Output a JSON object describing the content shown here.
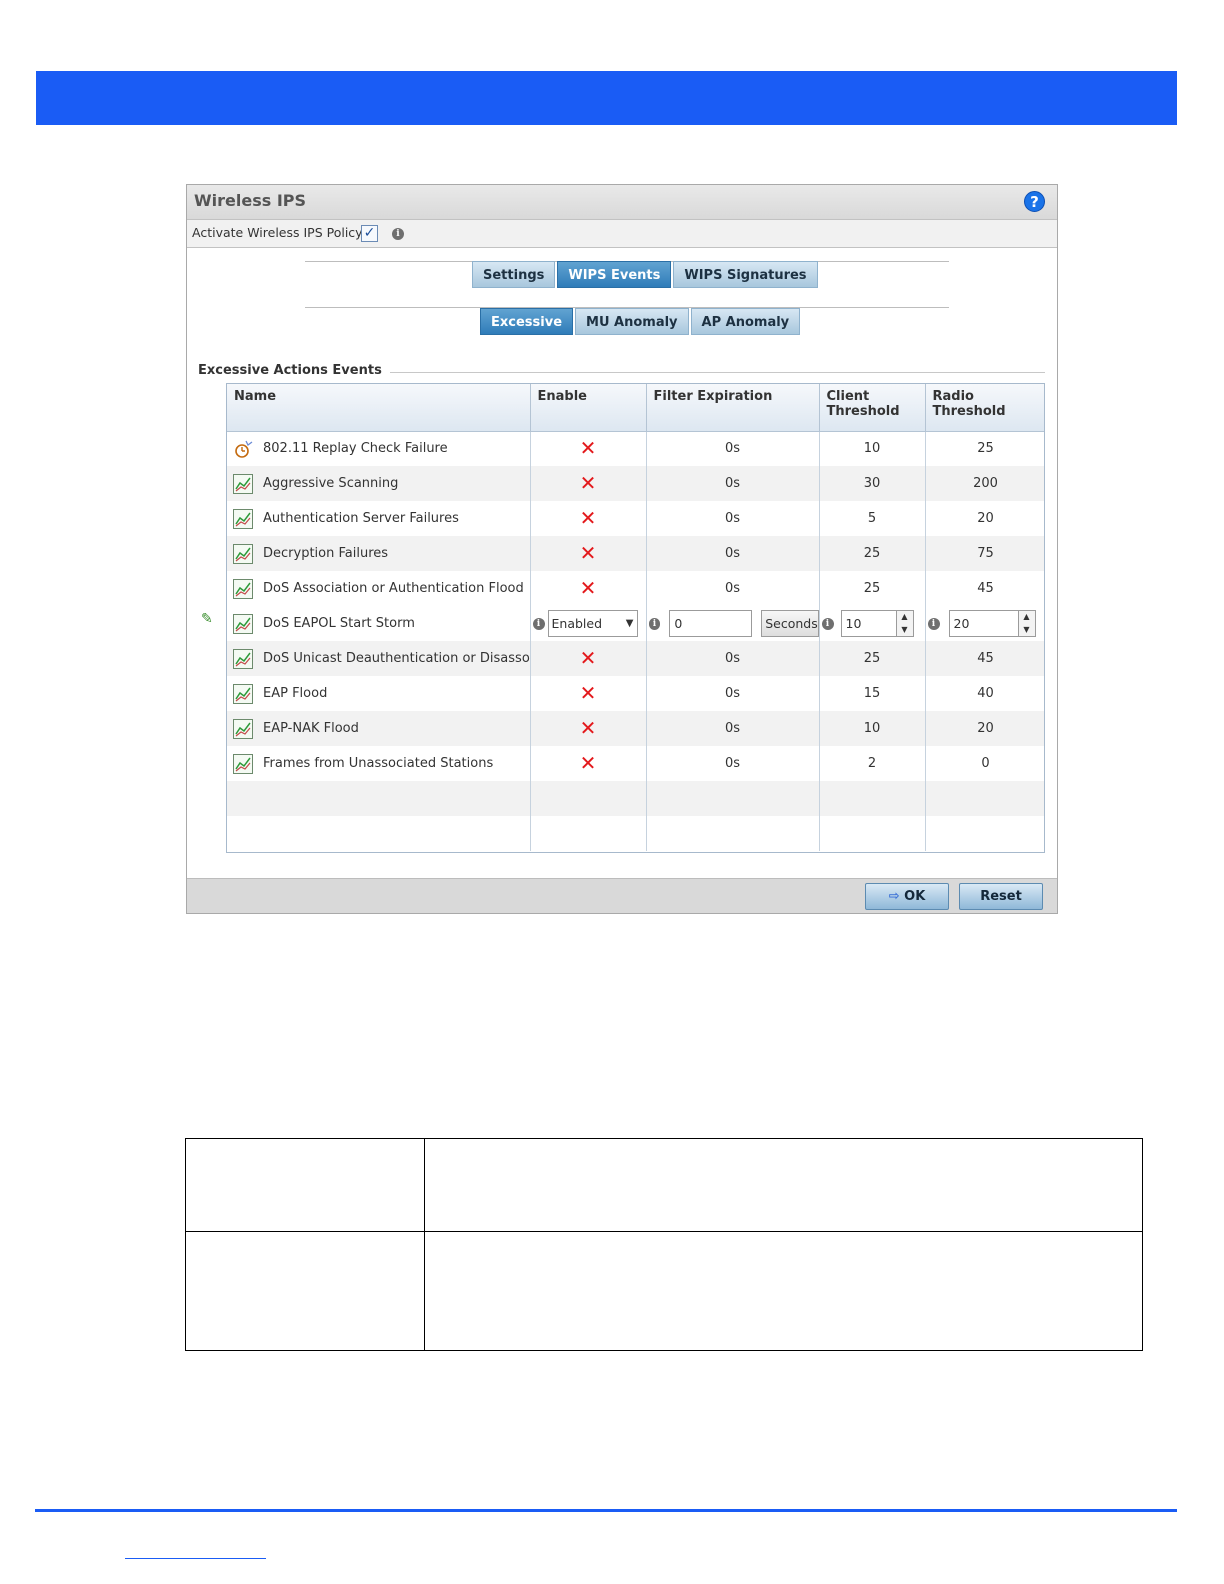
{
  "dialog": {
    "title": "Wireless IPS",
    "help_icon": "help-icon",
    "activate_label": "Activate Wireless IPS Policy",
    "activate_checked": true
  },
  "tabs": [
    {
      "label": "Settings",
      "active": false
    },
    {
      "label": "WIPS Events",
      "active": true
    },
    {
      "label": "WIPS Signatures",
      "active": false
    }
  ],
  "subtabs": [
    {
      "label": "Excessive",
      "active": true
    },
    {
      "label": "MU Anomaly",
      "active": false
    },
    {
      "label": "AP Anomaly",
      "active": false
    }
  ],
  "section_title": "Excessive Actions Events",
  "table": {
    "columns": [
      "Name",
      "Enable",
      "Filter Expiration",
      "Client Threshold",
      "Radio Threshold"
    ],
    "rows": [
      {
        "name": "802.11 Replay Check Failure",
        "icon": "replay-icon",
        "enable": "disabled",
        "filter": "0s",
        "client": "10",
        "radio": "25"
      },
      {
        "name": "Aggressive Scanning",
        "icon": "chart-icon",
        "enable": "disabled",
        "filter": "0s",
        "client": "30",
        "radio": "200"
      },
      {
        "name": "Authentication Server Failures",
        "icon": "chart-icon",
        "enable": "disabled",
        "filter": "0s",
        "client": "5",
        "radio": "20"
      },
      {
        "name": "Decryption Failures",
        "icon": "chart-icon",
        "enable": "disabled",
        "filter": "0s",
        "client": "25",
        "radio": "75"
      },
      {
        "name": "DoS Association or Authentication Flood",
        "icon": "chart-icon",
        "enable": "disabled",
        "filter": "0s",
        "client": "25",
        "radio": "45"
      },
      {
        "name": "DoS EAPOL Start Storm",
        "icon": "chart-icon",
        "editing": true,
        "enable_value": "Enabled",
        "filter_value": "0",
        "filter_unit": "Seconds",
        "client_value": "10",
        "radio_value": "20"
      },
      {
        "name": "DoS Unicast Deauthentication or Disassociation",
        "icon": "chart-icon",
        "enable": "disabled",
        "filter": "0s",
        "client": "25",
        "radio": "45"
      },
      {
        "name": "EAP Flood",
        "icon": "chart-icon",
        "enable": "disabled",
        "filter": "0s",
        "client": "15",
        "radio": "40"
      },
      {
        "name": "EAP-NAK Flood",
        "icon": "chart-icon",
        "enable": "disabled",
        "filter": "0s",
        "client": "10",
        "radio": "20"
      },
      {
        "name": "Frames from Unassociated Stations",
        "icon": "chart-icon",
        "enable": "disabled",
        "filter": "0s",
        "client": "2",
        "radio": "0"
      }
    ]
  },
  "buttons": {
    "ok": "OK",
    "reset": "Reset"
  },
  "colors": {
    "banner": "#1a5cf5",
    "disabled_mark": "#e3191c",
    "active_tab": "#2f7cb9"
  }
}
